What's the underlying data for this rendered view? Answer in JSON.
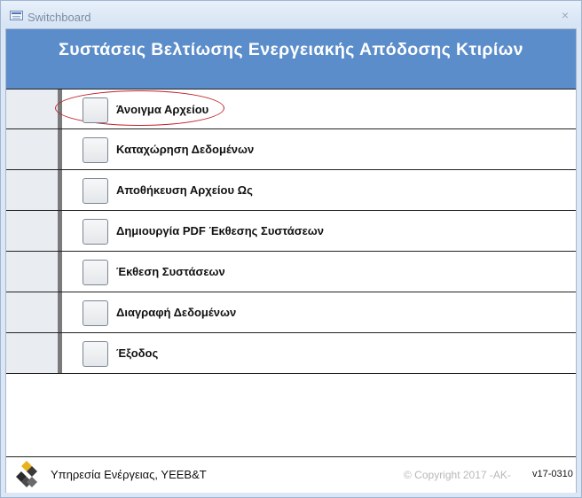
{
  "window": {
    "title": "Switchboard",
    "close_symbol": "×"
  },
  "banner": {
    "title": "Συστάσεις Βελτίωσης Ενεργειακής Απόδοσης Κτιρίων"
  },
  "menu": {
    "items": [
      {
        "label": "Άνοιγμα Αρχείου"
      },
      {
        "label": "Καταχώρηση Δεδομένων"
      },
      {
        "label": "Αποθήκευση Αρχείου Ως"
      },
      {
        "label": "Δημιουργία PDF Έκθεσης Συστάσεων"
      },
      {
        "label": "Έκθεση Συστάσεων"
      },
      {
        "label": "Διαγραφή Δεδομένων"
      },
      {
        "label": "Έξοδος"
      }
    ]
  },
  "footer": {
    "organization": "Υπηρεσία Ενέργειας, ΥΕΕΒ&Τ",
    "copyright": "© Copyright 2017 -AK-",
    "version": "v17-0310"
  },
  "colors": {
    "banner": "#5b8dcb",
    "highlight_ellipse": "#c0202a"
  },
  "icons": {
    "title": "form-icon",
    "close": "close-icon",
    "logo": "organization-logo-icon"
  }
}
